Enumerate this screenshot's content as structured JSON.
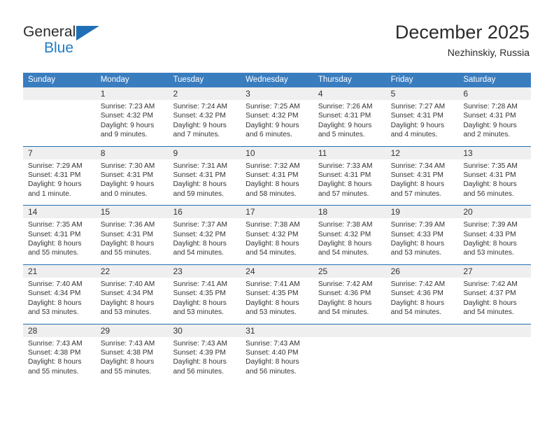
{
  "brand": {
    "name_top": "General",
    "name_bottom": "Blue",
    "accent_color": "#1f7cc4",
    "triangle_color": "#1f6fb5"
  },
  "header": {
    "title": "December 2025",
    "subtitle": "Nezhinskiy, Russia"
  },
  "calendar": {
    "header_bg": "#3a7dbf",
    "day_number_bg": "#efefef",
    "row_divider_color": "#1f6fb5",
    "weekdays": [
      "Sunday",
      "Monday",
      "Tuesday",
      "Wednesday",
      "Thursday",
      "Friday",
      "Saturday"
    ],
    "weeks": [
      [
        {
          "day": ""
        },
        {
          "day": "1",
          "sunrise": "Sunrise: 7:23 AM",
          "sunset": "Sunset: 4:32 PM",
          "daylight": "Daylight: 9 hours and 9 minutes."
        },
        {
          "day": "2",
          "sunrise": "Sunrise: 7:24 AM",
          "sunset": "Sunset: 4:32 PM",
          "daylight": "Daylight: 9 hours and 7 minutes."
        },
        {
          "day": "3",
          "sunrise": "Sunrise: 7:25 AM",
          "sunset": "Sunset: 4:32 PM",
          "daylight": "Daylight: 9 hours and 6 minutes."
        },
        {
          "day": "4",
          "sunrise": "Sunrise: 7:26 AM",
          "sunset": "Sunset: 4:31 PM",
          "daylight": "Daylight: 9 hours and 5 minutes."
        },
        {
          "day": "5",
          "sunrise": "Sunrise: 7:27 AM",
          "sunset": "Sunset: 4:31 PM",
          "daylight": "Daylight: 9 hours and 4 minutes."
        },
        {
          "day": "6",
          "sunrise": "Sunrise: 7:28 AM",
          "sunset": "Sunset: 4:31 PM",
          "daylight": "Daylight: 9 hours and 2 minutes."
        }
      ],
      [
        {
          "day": "7",
          "sunrise": "Sunrise: 7:29 AM",
          "sunset": "Sunset: 4:31 PM",
          "daylight": "Daylight: 9 hours and 1 minute."
        },
        {
          "day": "8",
          "sunrise": "Sunrise: 7:30 AM",
          "sunset": "Sunset: 4:31 PM",
          "daylight": "Daylight: 9 hours and 0 minutes."
        },
        {
          "day": "9",
          "sunrise": "Sunrise: 7:31 AM",
          "sunset": "Sunset: 4:31 PM",
          "daylight": "Daylight: 8 hours and 59 minutes."
        },
        {
          "day": "10",
          "sunrise": "Sunrise: 7:32 AM",
          "sunset": "Sunset: 4:31 PM",
          "daylight": "Daylight: 8 hours and 58 minutes."
        },
        {
          "day": "11",
          "sunrise": "Sunrise: 7:33 AM",
          "sunset": "Sunset: 4:31 PM",
          "daylight": "Daylight: 8 hours and 57 minutes."
        },
        {
          "day": "12",
          "sunrise": "Sunrise: 7:34 AM",
          "sunset": "Sunset: 4:31 PM",
          "daylight": "Daylight: 8 hours and 57 minutes."
        },
        {
          "day": "13",
          "sunrise": "Sunrise: 7:35 AM",
          "sunset": "Sunset: 4:31 PM",
          "daylight": "Daylight: 8 hours and 56 minutes."
        }
      ],
      [
        {
          "day": "14",
          "sunrise": "Sunrise: 7:35 AM",
          "sunset": "Sunset: 4:31 PM",
          "daylight": "Daylight: 8 hours and 55 minutes."
        },
        {
          "day": "15",
          "sunrise": "Sunrise: 7:36 AM",
          "sunset": "Sunset: 4:31 PM",
          "daylight": "Daylight: 8 hours and 55 minutes."
        },
        {
          "day": "16",
          "sunrise": "Sunrise: 7:37 AM",
          "sunset": "Sunset: 4:32 PM",
          "daylight": "Daylight: 8 hours and 54 minutes."
        },
        {
          "day": "17",
          "sunrise": "Sunrise: 7:38 AM",
          "sunset": "Sunset: 4:32 PM",
          "daylight": "Daylight: 8 hours and 54 minutes."
        },
        {
          "day": "18",
          "sunrise": "Sunrise: 7:38 AM",
          "sunset": "Sunset: 4:32 PM",
          "daylight": "Daylight: 8 hours and 54 minutes."
        },
        {
          "day": "19",
          "sunrise": "Sunrise: 7:39 AM",
          "sunset": "Sunset: 4:33 PM",
          "daylight": "Daylight: 8 hours and 53 minutes."
        },
        {
          "day": "20",
          "sunrise": "Sunrise: 7:39 AM",
          "sunset": "Sunset: 4:33 PM",
          "daylight": "Daylight: 8 hours and 53 minutes."
        }
      ],
      [
        {
          "day": "21",
          "sunrise": "Sunrise: 7:40 AM",
          "sunset": "Sunset: 4:34 PM",
          "daylight": "Daylight: 8 hours and 53 minutes."
        },
        {
          "day": "22",
          "sunrise": "Sunrise: 7:40 AM",
          "sunset": "Sunset: 4:34 PM",
          "daylight": "Daylight: 8 hours and 53 minutes."
        },
        {
          "day": "23",
          "sunrise": "Sunrise: 7:41 AM",
          "sunset": "Sunset: 4:35 PM",
          "daylight": "Daylight: 8 hours and 53 minutes."
        },
        {
          "day": "24",
          "sunrise": "Sunrise: 7:41 AM",
          "sunset": "Sunset: 4:35 PM",
          "daylight": "Daylight: 8 hours and 53 minutes."
        },
        {
          "day": "25",
          "sunrise": "Sunrise: 7:42 AM",
          "sunset": "Sunset: 4:36 PM",
          "daylight": "Daylight: 8 hours and 54 minutes."
        },
        {
          "day": "26",
          "sunrise": "Sunrise: 7:42 AM",
          "sunset": "Sunset: 4:36 PM",
          "daylight": "Daylight: 8 hours and 54 minutes."
        },
        {
          "day": "27",
          "sunrise": "Sunrise: 7:42 AM",
          "sunset": "Sunset: 4:37 PM",
          "daylight": "Daylight: 8 hours and 54 minutes."
        }
      ],
      [
        {
          "day": "28",
          "sunrise": "Sunrise: 7:43 AM",
          "sunset": "Sunset: 4:38 PM",
          "daylight": "Daylight: 8 hours and 55 minutes."
        },
        {
          "day": "29",
          "sunrise": "Sunrise: 7:43 AM",
          "sunset": "Sunset: 4:38 PM",
          "daylight": "Daylight: 8 hours and 55 minutes."
        },
        {
          "day": "30",
          "sunrise": "Sunrise: 7:43 AM",
          "sunset": "Sunset: 4:39 PM",
          "daylight": "Daylight: 8 hours and 56 minutes."
        },
        {
          "day": "31",
          "sunrise": "Sunrise: 7:43 AM",
          "sunset": "Sunset: 4:40 PM",
          "daylight": "Daylight: 8 hours and 56 minutes."
        },
        {
          "day": ""
        },
        {
          "day": ""
        },
        {
          "day": ""
        }
      ]
    ]
  }
}
